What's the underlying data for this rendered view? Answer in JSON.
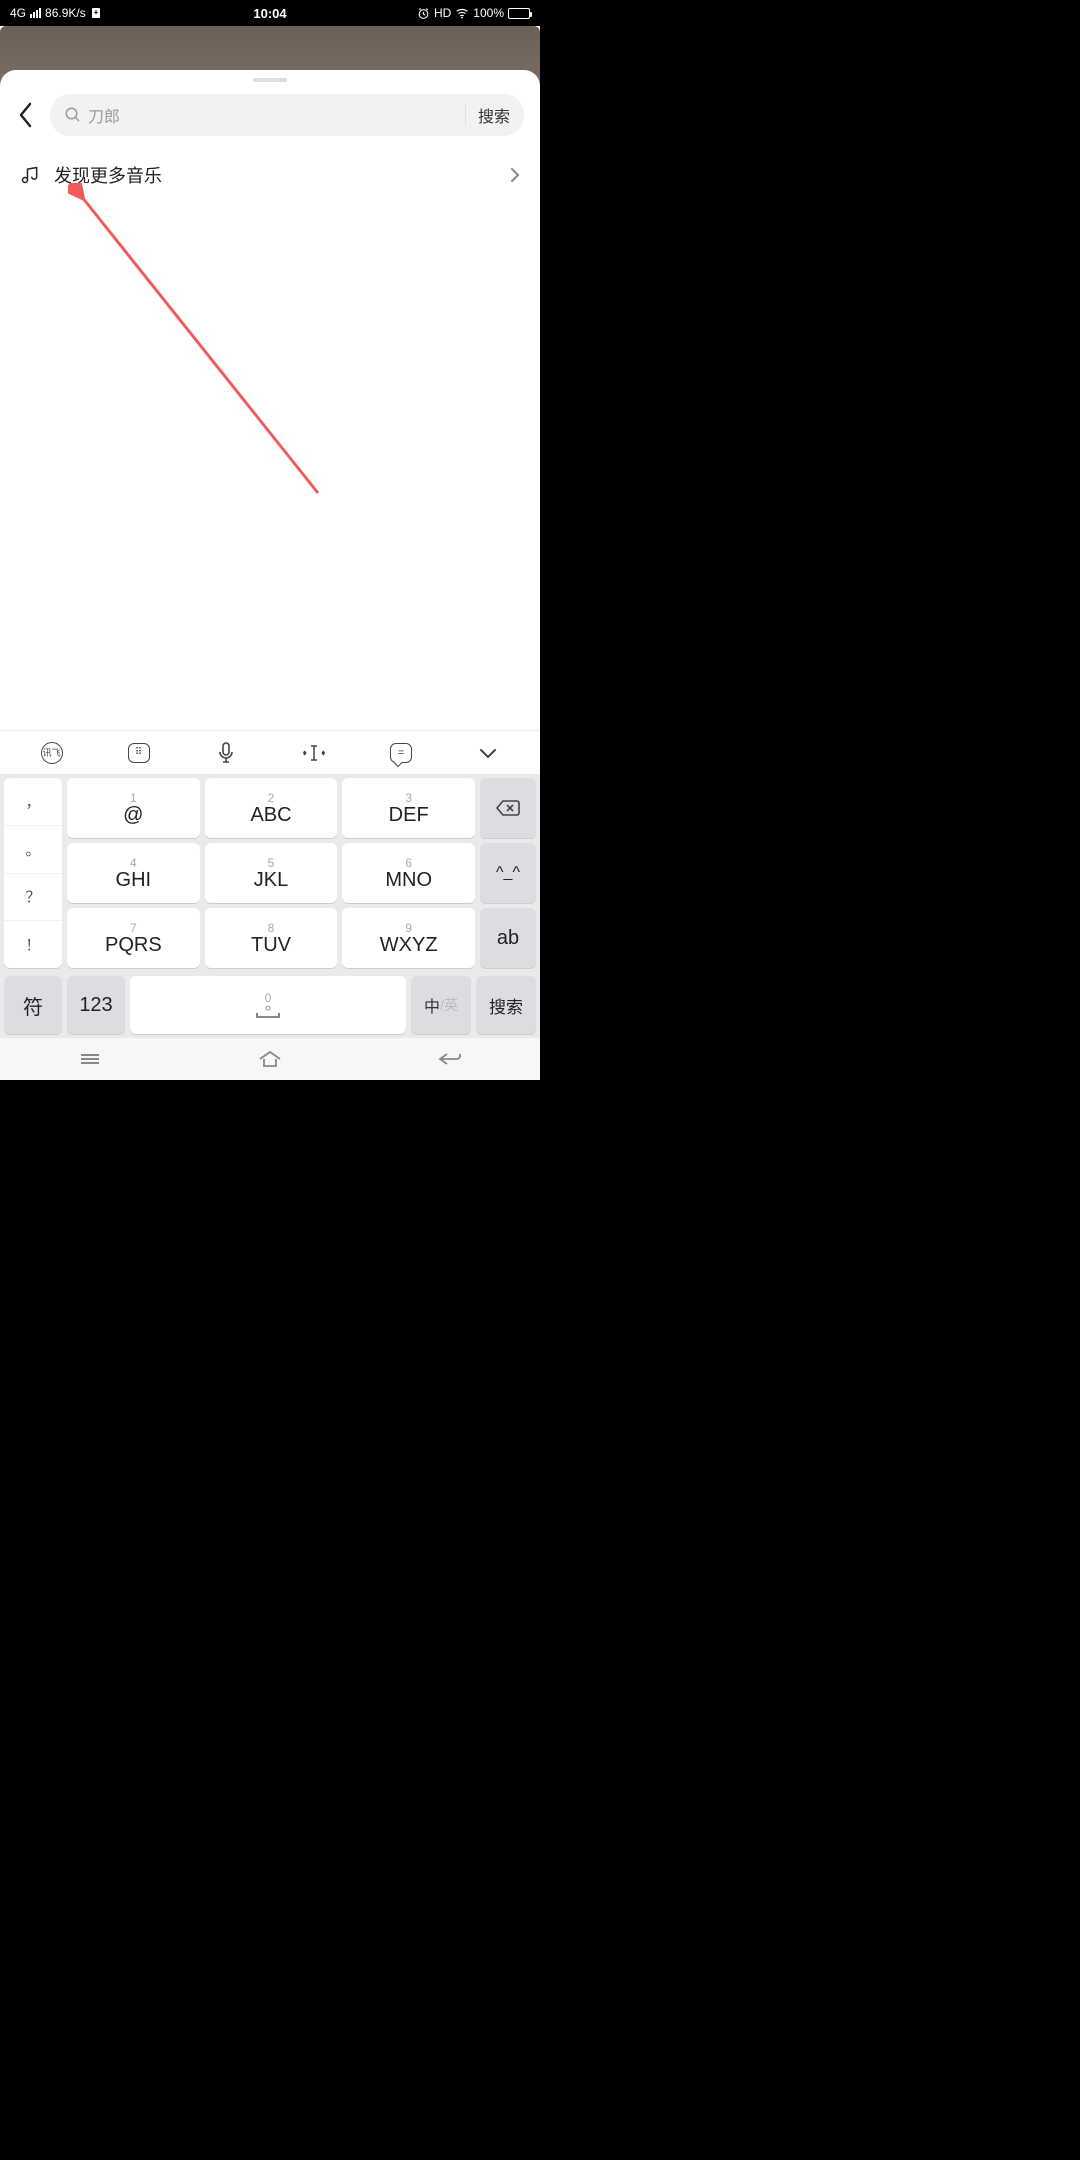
{
  "status": {
    "network": "4G",
    "speed": "86.9K/s",
    "time": "10:04",
    "hd": "HD",
    "battery_pct": "100%"
  },
  "search": {
    "placeholder": "刀郎",
    "button": "搜索"
  },
  "discover": {
    "label": "发现更多音乐"
  },
  "keyboard": {
    "toolbar_ifly": "讯飞",
    "side": {
      "comma": "，",
      "dot": "。",
      "qmark": "？",
      "excl": "！"
    },
    "keys": {
      "k1": {
        "num": "1",
        "main": "@"
      },
      "k2": {
        "num": "2",
        "main": "ABC"
      },
      "k3": {
        "num": "3",
        "main": "DEF"
      },
      "k4": {
        "num": "4",
        "main": "GHI"
      },
      "k5": {
        "num": "5",
        "main": "JKL"
      },
      "k6": {
        "num": "6",
        "main": "MNO"
      },
      "k7": {
        "num": "7",
        "main": "PQRS"
      },
      "k8": {
        "num": "8",
        "main": "TUV"
      },
      "k9": {
        "num": "9",
        "main": "WXYZ"
      },
      "emoji": "^_^",
      "ab": "ab",
      "sym": "符",
      "num123": "123",
      "spacenum": "0",
      "lang_zh": "中",
      "lang_en": "/英",
      "search": "搜索"
    }
  }
}
